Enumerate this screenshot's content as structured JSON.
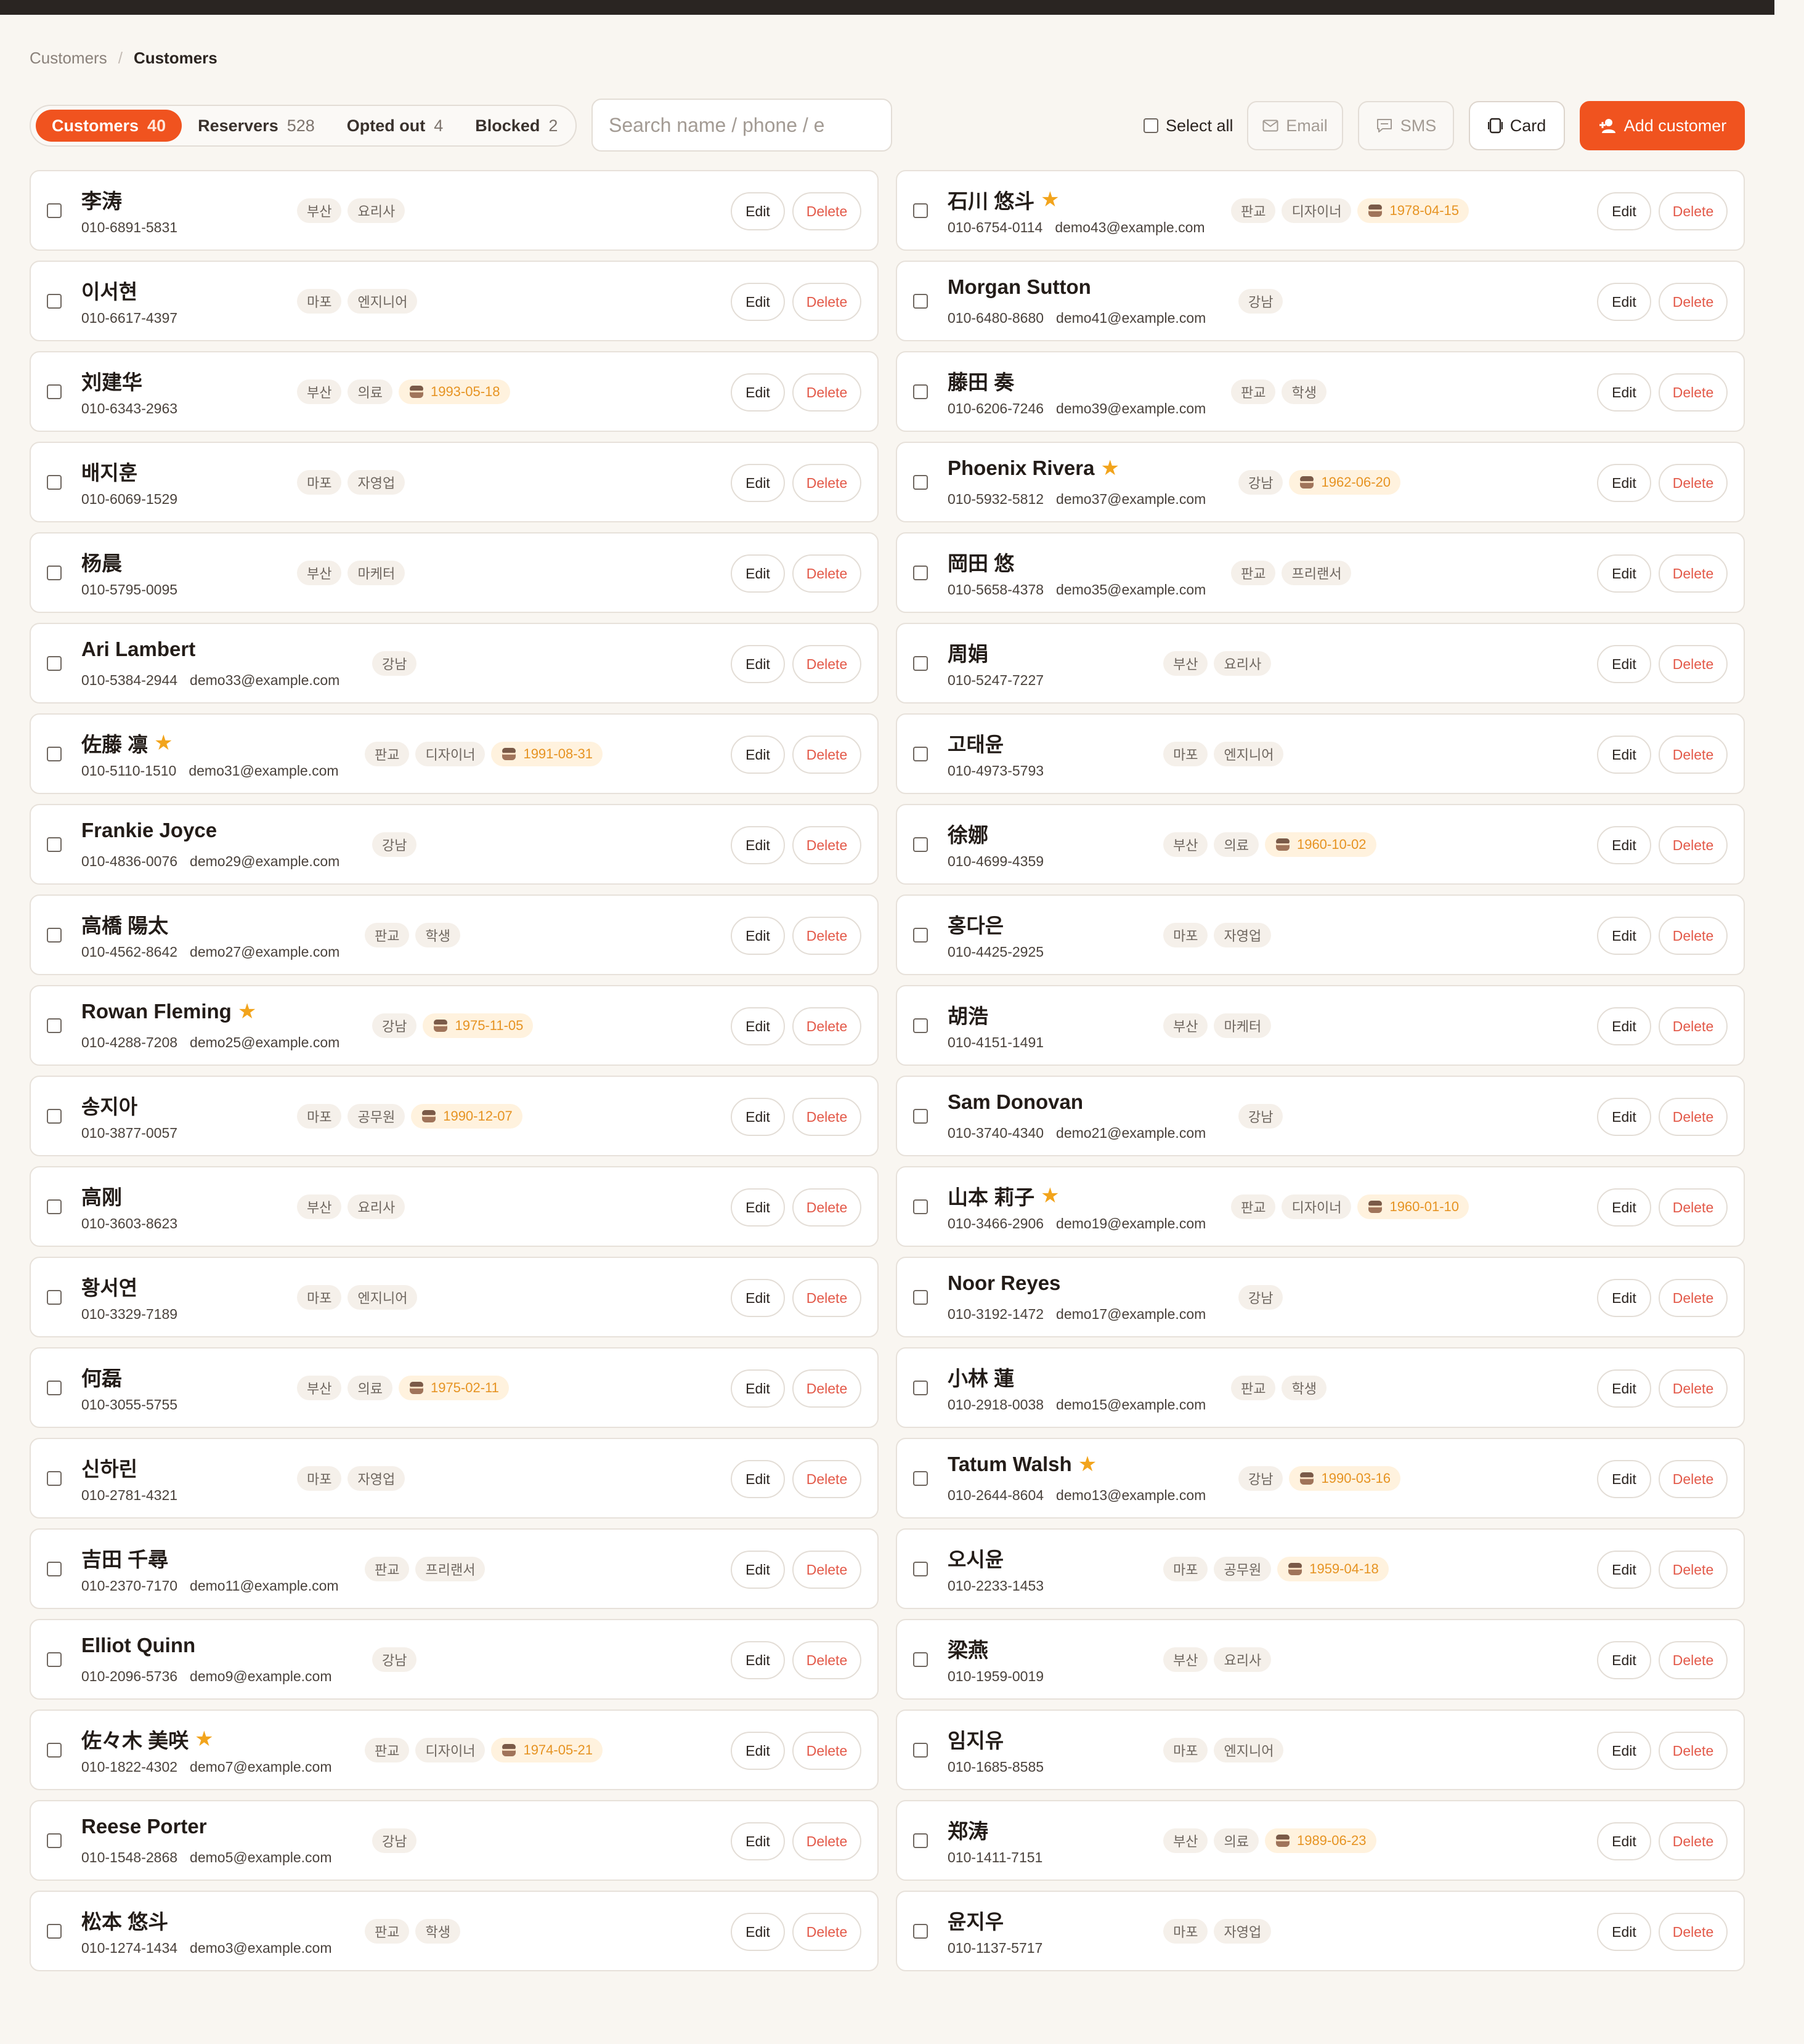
{
  "breadcrumb": {
    "parent": "Customers",
    "separator": "/",
    "current": "Customers"
  },
  "tabs": [
    {
      "label": "Customers",
      "count": "40",
      "active": true
    },
    {
      "label": "Reservers",
      "count": "528",
      "active": false
    },
    {
      "label": "Opted out",
      "count": "4",
      "active": false
    },
    {
      "label": "Blocked",
      "count": "2",
      "active": false
    }
  ],
  "search": {
    "placeholder": "Search name / phone / e"
  },
  "toolbar": {
    "select_all": "Select all",
    "email": "Email",
    "sms": "SMS",
    "card": "Card",
    "add": "Add customer"
  },
  "colors": {
    "accent": "#f0531f",
    "star": "#f2a41c",
    "delete": "#e35a4a",
    "birthday": "#e69322"
  },
  "row_actions": {
    "edit": "Edit",
    "delete": "Delete"
  },
  "customers": [
    {
      "name": "李涛",
      "star": false,
      "phone": "010-6891-5831",
      "email": "",
      "tags": [
        "부산",
        "요리사"
      ],
      "birthday": ""
    },
    {
      "name": "石川 悠斗",
      "star": true,
      "phone": "010-6754-0114",
      "email": "demo43@example.com",
      "tags": [
        "판교",
        "디자이너"
      ],
      "birthday": "1978-04-15"
    },
    {
      "name": "이서현",
      "star": false,
      "phone": "010-6617-4397",
      "email": "",
      "tags": [
        "마포",
        "엔지니어"
      ],
      "birthday": ""
    },
    {
      "name": "Morgan Sutton",
      "star": false,
      "phone": "010-6480-8680",
      "email": "demo41@example.com",
      "tags": [
        "강남"
      ],
      "birthday": ""
    },
    {
      "name": "刘建华",
      "star": false,
      "phone": "010-6343-2963",
      "email": "",
      "tags": [
        "부산",
        "의료"
      ],
      "birthday": "1993-05-18"
    },
    {
      "name": "藤田 奏",
      "star": false,
      "phone": "010-6206-7246",
      "email": "demo39@example.com",
      "tags": [
        "판교",
        "학생"
      ],
      "birthday": ""
    },
    {
      "name": "배지훈",
      "star": false,
      "phone": "010-6069-1529",
      "email": "",
      "tags": [
        "마포",
        "자영업"
      ],
      "birthday": ""
    },
    {
      "name": "Phoenix Rivera",
      "star": true,
      "phone": "010-5932-5812",
      "email": "demo37@example.com",
      "tags": [
        "강남"
      ],
      "birthday": "1962-06-20"
    },
    {
      "name": "杨晨",
      "star": false,
      "phone": "010-5795-0095",
      "email": "",
      "tags": [
        "부산",
        "마케터"
      ],
      "birthday": ""
    },
    {
      "name": "岡田 悠",
      "star": false,
      "phone": "010-5658-4378",
      "email": "demo35@example.com",
      "tags": [
        "판교",
        "프리랜서"
      ],
      "birthday": ""
    },
    {
      "name": "Ari Lambert",
      "star": false,
      "phone": "010-5384-2944",
      "email": "demo33@example.com",
      "tags": [
        "강남"
      ],
      "birthday": ""
    },
    {
      "name": "周娟",
      "star": false,
      "phone": "010-5247-7227",
      "email": "",
      "tags": [
        "부산",
        "요리사"
      ],
      "birthday": ""
    },
    {
      "name": "佐藤 凛",
      "star": true,
      "phone": "010-5110-1510",
      "email": "demo31@example.com",
      "tags": [
        "판교",
        "디자이너"
      ],
      "birthday": "1991-08-31"
    },
    {
      "name": "고태윤",
      "star": false,
      "phone": "010-4973-5793",
      "email": "",
      "tags": [
        "마포",
        "엔지니어"
      ],
      "birthday": ""
    },
    {
      "name": "Frankie Joyce",
      "star": false,
      "phone": "010-4836-0076",
      "email": "demo29@example.com",
      "tags": [
        "강남"
      ],
      "birthday": ""
    },
    {
      "name": "徐娜",
      "star": false,
      "phone": "010-4699-4359",
      "email": "",
      "tags": [
        "부산",
        "의료"
      ],
      "birthday": "1960-10-02"
    },
    {
      "name": "高橋 陽太",
      "star": false,
      "phone": "010-4562-8642",
      "email": "demo27@example.com",
      "tags": [
        "판교",
        "학생"
      ],
      "birthday": ""
    },
    {
      "name": "홍다은",
      "star": false,
      "phone": "010-4425-2925",
      "email": "",
      "tags": [
        "마포",
        "자영업"
      ],
      "birthday": ""
    },
    {
      "name": "Rowan Fleming",
      "star": true,
      "phone": "010-4288-7208",
      "email": "demo25@example.com",
      "tags": [
        "강남"
      ],
      "birthday": "1975-11-05"
    },
    {
      "name": "胡浩",
      "star": false,
      "phone": "010-4151-1491",
      "email": "",
      "tags": [
        "부산",
        "마케터"
      ],
      "birthday": ""
    },
    {
      "name": "송지아",
      "star": false,
      "phone": "010-3877-0057",
      "email": "",
      "tags": [
        "마포",
        "공무원"
      ],
      "birthday": "1990-12-07"
    },
    {
      "name": "Sam Donovan",
      "star": false,
      "phone": "010-3740-4340",
      "email": "demo21@example.com",
      "tags": [
        "강남"
      ],
      "birthday": ""
    },
    {
      "name": "高刚",
      "star": false,
      "phone": "010-3603-8623",
      "email": "",
      "tags": [
        "부산",
        "요리사"
      ],
      "birthday": ""
    },
    {
      "name": "山本 莉子",
      "star": true,
      "phone": "010-3466-2906",
      "email": "demo19@example.com",
      "tags": [
        "판교",
        "디자이너"
      ],
      "birthday": "1960-01-10"
    },
    {
      "name": "황서연",
      "star": false,
      "phone": "010-3329-7189",
      "email": "",
      "tags": [
        "마포",
        "엔지니어"
      ],
      "birthday": ""
    },
    {
      "name": "Noor Reyes",
      "star": false,
      "phone": "010-3192-1472",
      "email": "demo17@example.com",
      "tags": [
        "강남"
      ],
      "birthday": ""
    },
    {
      "name": "何磊",
      "star": false,
      "phone": "010-3055-5755",
      "email": "",
      "tags": [
        "부산",
        "의료"
      ],
      "birthday": "1975-02-11"
    },
    {
      "name": "小林 蓮",
      "star": false,
      "phone": "010-2918-0038",
      "email": "demo15@example.com",
      "tags": [
        "판교",
        "학생"
      ],
      "birthday": ""
    },
    {
      "name": "신하린",
      "star": false,
      "phone": "010-2781-4321",
      "email": "",
      "tags": [
        "마포",
        "자영업"
      ],
      "birthday": ""
    },
    {
      "name": "Tatum Walsh",
      "star": true,
      "phone": "010-2644-8604",
      "email": "demo13@example.com",
      "tags": [
        "강남"
      ],
      "birthday": "1990-03-16"
    },
    {
      "name": "吉田 千尋",
      "star": false,
      "phone": "010-2370-7170",
      "email": "demo11@example.com",
      "tags": [
        "판교",
        "프리랜서"
      ],
      "birthday": ""
    },
    {
      "name": "오시윤",
      "star": false,
      "phone": "010-2233-1453",
      "email": "",
      "tags": [
        "마포",
        "공무원"
      ],
      "birthday": "1959-04-18"
    },
    {
      "name": "Elliot Quinn",
      "star": false,
      "phone": "010-2096-5736",
      "email": "demo9@example.com",
      "tags": [
        "강남"
      ],
      "birthday": ""
    },
    {
      "name": "梁燕",
      "star": false,
      "phone": "010-1959-0019",
      "email": "",
      "tags": [
        "부산",
        "요리사"
      ],
      "birthday": ""
    },
    {
      "name": "佐々木 美咲",
      "star": true,
      "phone": "010-1822-4302",
      "email": "demo7@example.com",
      "tags": [
        "판교",
        "디자이너"
      ],
      "birthday": "1974-05-21"
    },
    {
      "name": "임지유",
      "star": false,
      "phone": "010-1685-8585",
      "email": "",
      "tags": [
        "마포",
        "엔지니어"
      ],
      "birthday": ""
    },
    {
      "name": "Reese Porter",
      "star": false,
      "phone": "010-1548-2868",
      "email": "demo5@example.com",
      "tags": [
        "강남"
      ],
      "birthday": ""
    },
    {
      "name": "郑涛",
      "star": false,
      "phone": "010-1411-7151",
      "email": "",
      "tags": [
        "부산",
        "의료"
      ],
      "birthday": "1989-06-23"
    },
    {
      "name": "松本 悠斗",
      "star": false,
      "phone": "010-1274-1434",
      "email": "demo3@example.com",
      "tags": [
        "판교",
        "학생"
      ],
      "birthday": ""
    },
    {
      "name": "윤지우",
      "star": false,
      "phone": "010-1137-5717",
      "email": "",
      "tags": [
        "마포",
        "자영업"
      ],
      "birthday": ""
    }
  ]
}
